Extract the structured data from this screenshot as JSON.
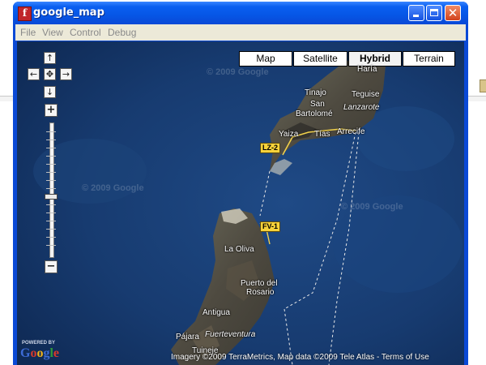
{
  "window": {
    "title": "google_map",
    "app_icon": "flash-player-icon",
    "buttons": [
      "minimize-icon",
      "maximize-icon",
      "close-icon"
    ]
  },
  "menu": [
    "File",
    "View",
    "Control",
    "Debug"
  ],
  "map": {
    "type_controls": [
      {
        "label": "Map",
        "active": false
      },
      {
        "label": "Satellite",
        "active": false
      },
      {
        "label": "Hybrid",
        "active": true
      },
      {
        "label": "Terrain",
        "active": false
      }
    ],
    "pan_controls": {
      "up": "↑",
      "down": "↓",
      "left": "←",
      "right": "→",
      "center": "✥"
    },
    "zoom": {
      "plus": "+",
      "minus": "−",
      "level_fraction": 0.55
    },
    "places": {
      "haria": "Haría",
      "tinajo": "Tinajo",
      "san": "San",
      "bartolome": "Bartolomé",
      "teguise": "Teguise",
      "lanzarote": "Lanzarote",
      "yaiza": "Yaiza",
      "tias": "Tías",
      "arrecife": "Arrecife",
      "la_oliva": "La Oliva",
      "puerto_del": "Puerto del",
      "rosario": "Rosario",
      "antigua": "Antigua",
      "pajara": "Pájara",
      "fuerteventura": "Fuerteventura",
      "tuineje": "Tuineje"
    },
    "road_shields": {
      "lz2": "LZ-2",
      "fv1": "FV-1"
    },
    "watermark": "© 2009 Google",
    "copyright": "Imagery ©2009 TerraMetrics, Map data ©2009 Tele Atlas - Terms of Use",
    "powered_by": "POWERED BY",
    "logo": {
      "letters": [
        "G",
        "o",
        "o",
        "g",
        "l",
        "e"
      ],
      "colors": [
        "#3d6bd6",
        "#d83a2a",
        "#f3b31a",
        "#3d6bd6",
        "#2f9a3a",
        "#d83a2a"
      ]
    }
  }
}
